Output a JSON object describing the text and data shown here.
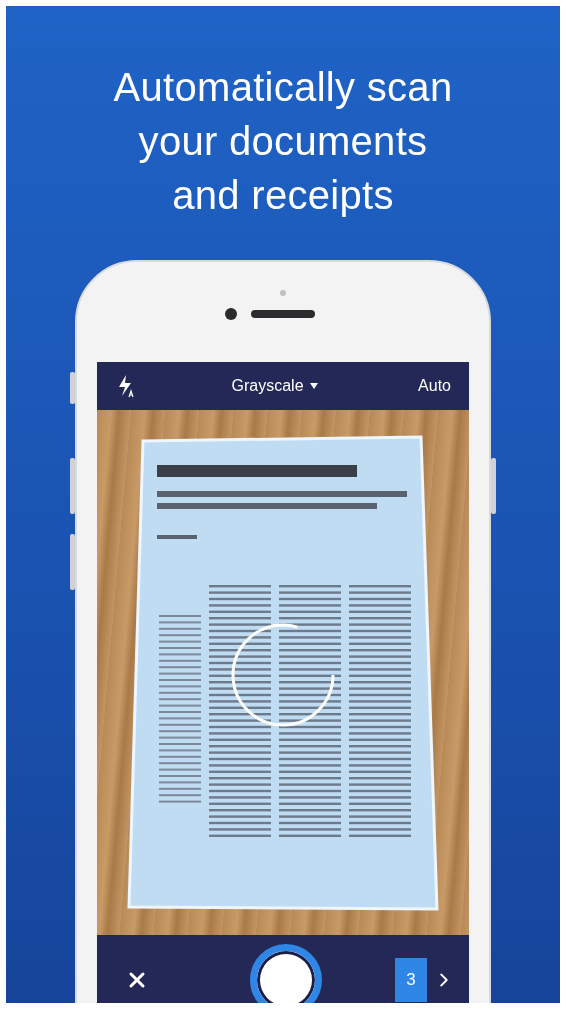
{
  "headline": "Automatically scan your documents and receipts",
  "top_bar": {
    "color_mode": "Grayscale",
    "scan_mode": "Auto"
  },
  "bottom_bar": {
    "page_count": "3"
  }
}
